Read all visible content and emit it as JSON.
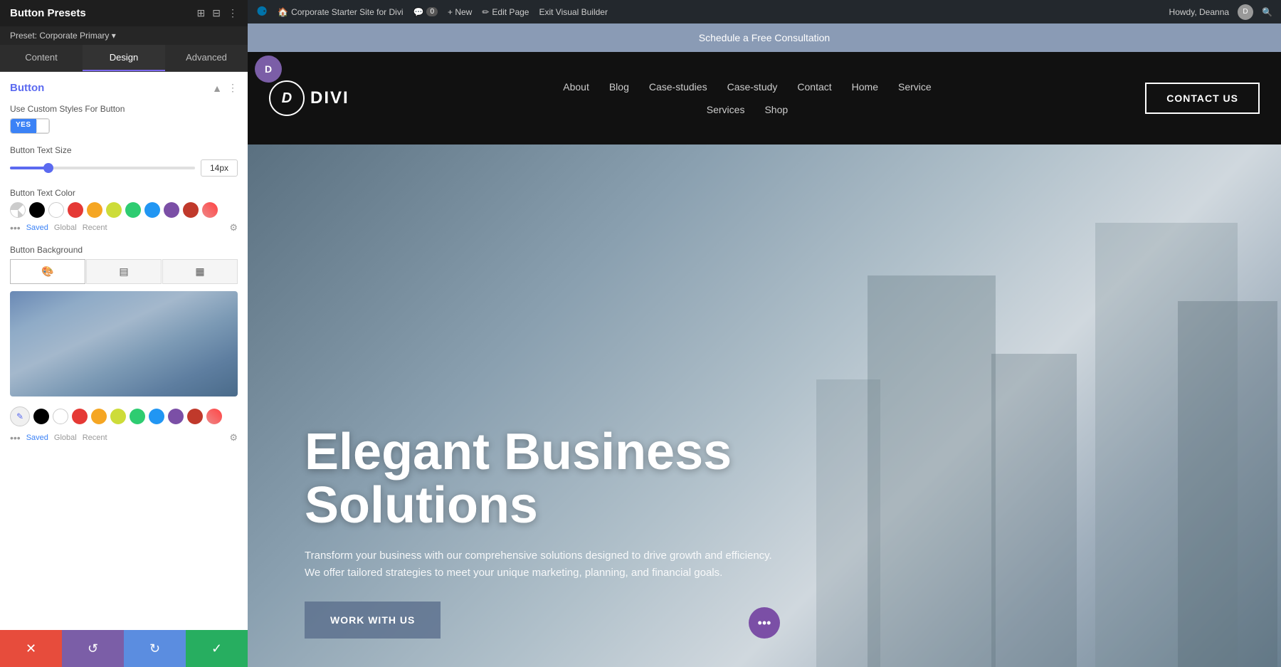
{
  "panel": {
    "title": "Button Presets",
    "preset_label": "Preset: Corporate Primary ▾",
    "tabs": [
      "Content",
      "Design",
      "Advanced"
    ],
    "active_tab": "Design",
    "section_title": "Button",
    "use_custom_styles_label": "Use Custom Styles For Button",
    "toggle_yes": "YES",
    "button_text_size_label": "Button Text Size",
    "button_text_size_value": "14px",
    "button_text_color_label": "Button Text Color",
    "saved_label": "Saved",
    "global_label": "Global",
    "recent_label": "Recent",
    "button_background_label": "Button Background"
  },
  "colors": {
    "black": "#000000",
    "white": "#ffffff",
    "red": "#e53935",
    "orange": "#f5a623",
    "yellow": "#cddc39",
    "green": "#2ecc71",
    "blue": "#2196f3",
    "purple": "#7b4fa6",
    "magenta": "#c0392b"
  },
  "wp_admin": {
    "site_name": "Corporate Starter Site for Divi",
    "comment_count": "0",
    "new_label": "+ New",
    "edit_page_label": "Edit Page",
    "exit_builder_label": "Exit Visual Builder",
    "howdy_label": "Howdy, Deanna"
  },
  "site": {
    "schedule_bar_text": "Schedule a Free Consultation",
    "logo_letter": "D",
    "logo_text": "DIVI",
    "nav_links": [
      "About",
      "Blog",
      "Case-studies",
      "Case-study",
      "Contact",
      "Home",
      "Service"
    ],
    "nav_links_bottom": [
      "Services",
      "Shop"
    ],
    "contact_us_label": "CONTACT US",
    "hero_title": "Elegant Business Solutions",
    "hero_subtitle": "Transform your business with our comprehensive solutions designed to drive growth and efficiency. We offer tailored strategies to meet your unique marketing, planning, and financial goals.",
    "hero_cta": "WORK WITH US"
  },
  "bottom_bar": {
    "cancel_icon": "✕",
    "undo_icon": "↺",
    "redo_icon": "↻",
    "save_icon": "✓"
  }
}
